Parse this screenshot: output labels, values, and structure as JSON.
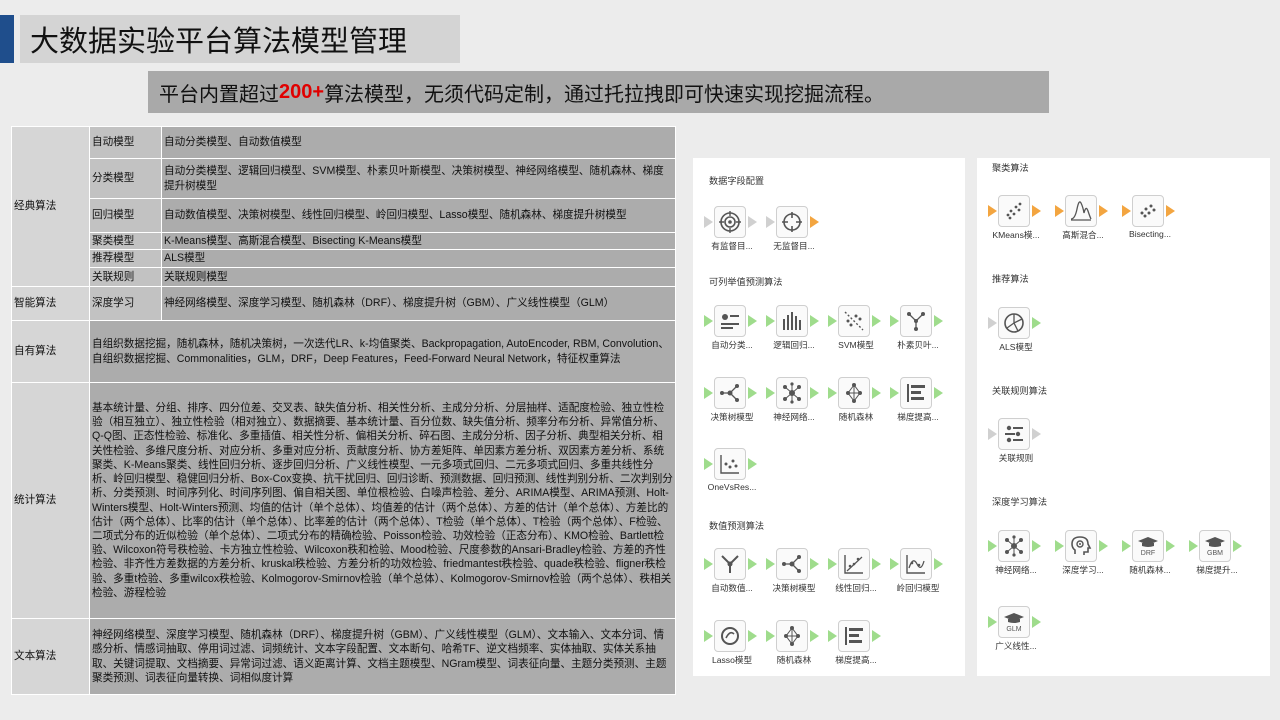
{
  "header": {
    "title": "大数据实验平台算法模型管理",
    "subtitle_pre": "平台内置超过",
    "subtitle_highlight": "200+",
    "subtitle_post": "算法模型，无须代码定制，通过托拉拽即可快速实现挖掘流程。"
  },
  "table": {
    "classic": {
      "category": "经典算法",
      "rows": [
        {
          "sub": "自动模型",
          "desc": "自动分类模型、自动数值模型"
        },
        {
          "sub": "分类模型",
          "desc": "自动分类模型、逻辑回归模型、SVM模型、朴素贝叶斯模型、决策树模型、神经网络模型、随机森林、梯度提升树模型"
        },
        {
          "sub": "回归模型",
          "desc": "自动数值模型、决策树模型、线性回归模型、岭回归模型、Lasso模型、随机森林、梯度提升树模型"
        },
        {
          "sub": "聚类模型",
          "desc": "K-Means模型、高斯混合模型、Bisecting K-Means模型"
        },
        {
          "sub": "推荐模型",
          "desc": "ALS模型"
        },
        {
          "sub": "关联规则",
          "desc": "关联规则模型"
        }
      ]
    },
    "smart": {
      "category": "智能算法",
      "sub": "深度学习",
      "desc": "神经网络模型、深度学习模型、随机森林（DRF）、梯度提升树（GBM）、广义线性模型（GLM）"
    },
    "own": {
      "category": "自有算法",
      "desc": "自组织数据挖掘，随机森林，随机决策树，一次迭代LR、k-均值聚类、Backpropagation, AutoEncoder, RBM, Convolution、自组织数据挖掘、Commonalities，GLM，DRF，Deep Features，Feed-Forward Neural Network，特征权重算法"
    },
    "stats": {
      "category": "统计算法",
      "desc": "基本统计量、分组、排序、四分位差、交叉表、缺失值分析、相关性分析、主成分分析、分层抽样、适配度检验、独立性检验（相互独立）、独立性检验（相对独立）、数据摘要、基本统计量、百分位数、缺失值分析、频率分布分析、异常值分析、Q-Q图、正态性检验、标准化、多重插值、相关性分析、偏相关分析、碎石图、主成分分析、因子分析、典型相关分析、相关性检验、多维尺度分析、对应分析、多重对应分析、贡献度分析、协方差矩阵、单因素方差分析、双因素方差分析、系统聚类、K-Means聚类、线性回归分析、逐步回归分析、广义线性模型、一元多项式回归、二元多项式回归、多重共线性分析、岭回归模型、稳健回归分析、Box-Cox变换、抗干扰回归、回归诊断、预测数据、回归预测、线性判别分析、二次判别分析、分类预测、时间序列化、时间序列图、偏自相关图、单位根检验、白噪声检验、差分、ARIMA模型、ARIMA预测、Holt-Winters模型、Holt-Winters预测、均值的估计（单个总体）、均值差的估计（两个总体）、方差的估计（单个总体）、方差比的估计（两个总体）、比率的估计（单个总体）、比率差的估计（两个总体）、T检验（单个总体）、T检验（两个总体）、F检验、二项式分布的近似检验（单个总体）、二项式分布的精确检验、Poisson检验、功效检验（正态分布）、KMO检验、Bartlett检验、Wilcoxon符号秩检验、卡方独立性检验、Wilcoxon秩和检验、Mood检验、尺度参数的Ansari-Bradley检验、方差的齐性检验、非齐性方差数据的方差分析、kruskal秩检验、方差分析的功效检验、friedmantest秩检验、quade秩检验、fligner秩检验、多重t检验、多重wilcox秩检验、Kolmogorov-Smirnov检验（单个总体）、Kolmogorov-Smirnov检验（两个总体）、秩相关检验、游程检验"
    },
    "text": {
      "category": "文本算法",
      "desc": "神经网络模型、深度学习模型、随机森林（DRF）、梯度提升树（GBM）、广义线性模型（GLM）、文本输入、文本分词、情感分析、情感词抽取、停用词过滤、词频统计、文本字段配置、文本断句、哈希TF、逆文档频率、实体抽取、实体关系抽取、关键词提取、文档摘要、异常词过滤、语义距离计算、文档主题模型、NGram模型、词表征向量、主题分类预测、主题聚类预测、词表征向量转换、词相似度计算"
    }
  },
  "panel1": {
    "sec1": "数据字段配置",
    "sec2": "可列举值预测算法",
    "sec3": "数值预测算法",
    "nodes1": [
      "有监督目...",
      "无监督目..."
    ],
    "nodes2": [
      "自动分类...",
      "逻辑回归...",
      "SVM模型",
      "朴素贝叶..."
    ],
    "nodes3": [
      "决策树模型",
      "神经网络...",
      "随机森林",
      "梯度提高..."
    ],
    "nodes4": [
      "OneVsRes..."
    ],
    "nodes5": [
      "自动数值...",
      "决策树模型",
      "线性回归...",
      "岭回归模型"
    ],
    "nodes6": [
      "Lasso模型",
      "随机森林",
      "梯度提高..."
    ]
  },
  "panel2": {
    "sec1": "聚类算法",
    "sec2": "推荐算法",
    "sec3": "关联规则算法",
    "sec4": "深度学习算法",
    "nodes1": [
      "KMeans模...",
      "高斯混合...",
      "Bisecting..."
    ],
    "nodes2": [
      "ALS模型"
    ],
    "nodes3": [
      "关联规则"
    ],
    "nodes4": [
      "神经网络...",
      "深度学习...",
      "随机森林...",
      "梯度提升..."
    ],
    "nodes5": [
      "广义线性..."
    ],
    "icon_text": {
      "drf": "DRF",
      "gbm": "GBM",
      "glm": "GLM"
    }
  }
}
